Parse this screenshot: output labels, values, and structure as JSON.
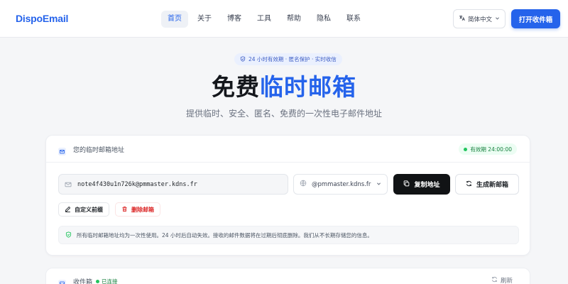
{
  "header": {
    "brand": "DispoEmail",
    "nav": [
      {
        "label": "首页",
        "active": true
      },
      {
        "label": "关于"
      },
      {
        "label": "博客"
      },
      {
        "label": "工具"
      },
      {
        "label": "帮助"
      },
      {
        "label": "隐私"
      },
      {
        "label": "联系"
      }
    ],
    "language": "简体中文",
    "open_inbox": "打开收件箱"
  },
  "hero": {
    "badge": "24 小时有效期 · 匿名保护 · 实时收信",
    "title_prefix": "免费",
    "title_accent": "临时邮箱",
    "subtitle": "提供临时、安全、匿名、免费的一次性电子邮件地址"
  },
  "address_card": {
    "title": "您的临时邮箱地址",
    "validity": "有效期 24:00:00",
    "address": "note4f430u1n726k@pmmaster.kdns.fr",
    "domain": "@pmmaster.kdns.fr",
    "copy_label": "复制地址",
    "generate_label": "生成新邮箱",
    "custom_label": "自定义前缀",
    "delete_label": "删除邮箱",
    "notice": "所有临时邮箱地址均为一次性使用。24 小时后自动失效。接收的邮件数据将在过期后彻底删除。我们从不长期存储您的信息。"
  },
  "inbox_card": {
    "title": "收件箱",
    "status": "已连接",
    "refresh_label": "刷新"
  },
  "colors": {
    "accent": "#2563eb",
    "success": "#22c55e",
    "danger": "#dc2626"
  }
}
